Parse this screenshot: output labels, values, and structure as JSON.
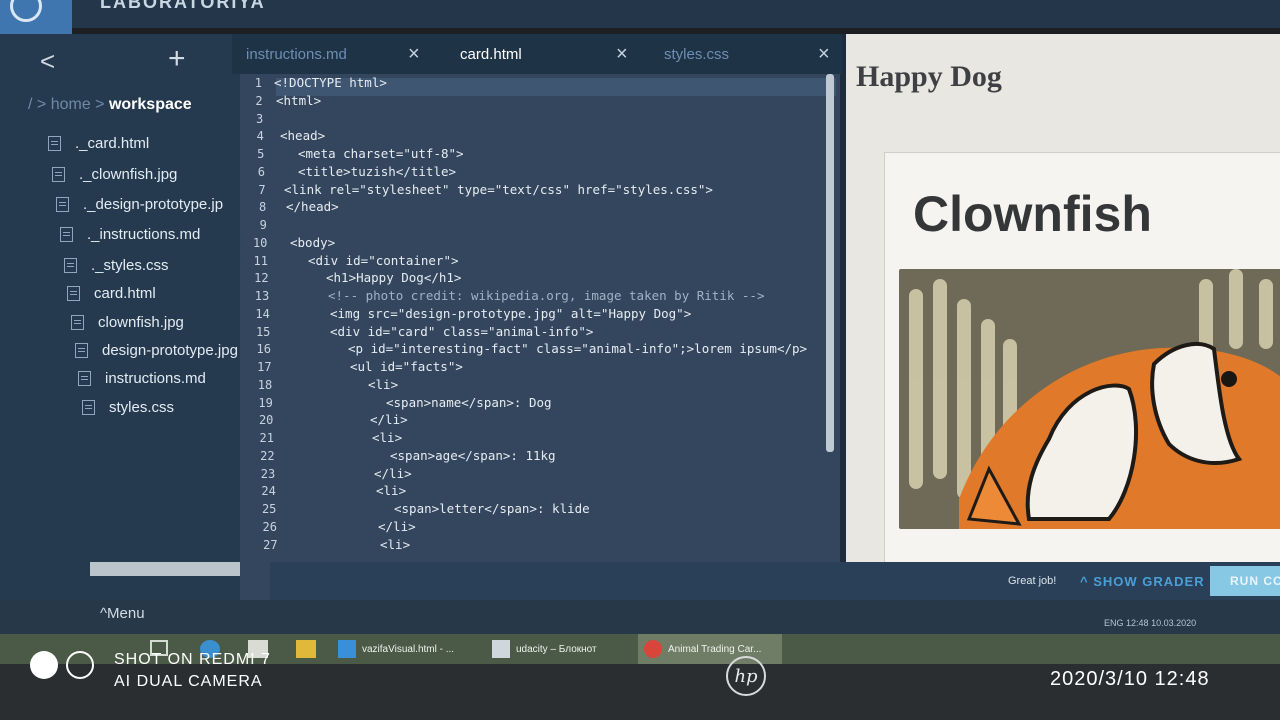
{
  "window": {
    "top_label": "LABORATORIYA"
  },
  "sidebar": {
    "back_glyph": "<",
    "add_glyph": "+",
    "breadcrumb": {
      "root": "/ >",
      "home": "home",
      "sep": " > ",
      "current": "workspace"
    },
    "files": [
      "._card.html",
      "._clownfish.jpg",
      "._design-prototype.jp",
      "._instructions.md",
      "._styles.css",
      "card.html",
      "clownfish.jpg",
      "design-prototype.jpg",
      "instructions.md",
      "styles.css"
    ]
  },
  "tabs": [
    {
      "label": "instructions.md",
      "close": "×"
    },
    {
      "label": "card.html",
      "close": "×"
    },
    {
      "label": "styles.css",
      "close": "×"
    }
  ],
  "editor": {
    "line_numbers": [
      "1",
      "2",
      "3",
      "4",
      "5",
      "6",
      "7",
      "8",
      "9",
      "10",
      "11",
      "12",
      "13",
      "14",
      "15",
      "16",
      "17",
      "18",
      "19",
      "20",
      "21",
      "22",
      "23",
      "24",
      "25",
      "26",
      "27"
    ],
    "lines": [
      "<!DOCTYPE html>",
      "<html>",
      "",
      "<head>",
      "<meta charset=\"utf-8\">",
      "<title>tuzish</title>",
      "<link rel=\"stylesheet\" type=\"text/css\" href=\"styles.css\">",
      "</head>",
      "",
      "<body>",
      "<div id=\"container\">",
      "<h1>Happy Dog</h1>",
      "<!-- photo credit: wikipedia.org, image taken by Ritik -->",
      "<img src=\"design-prototype.jpg\" alt=\"Happy Dog\">",
      "<div id=\"card\" class=\"animal-info\">",
      "<p id=\"interesting-fact\" class=\"animal-info\";>lorem ipsum</p>",
      "<ul id=\"facts\">",
      "<li>",
      "<span>name</span>: Dog",
      "</li>",
      "<li>",
      "<span>age</span>: 11kg",
      "</li>",
      "<li>",
      "<span>letter</span>: klide",
      "</li>",
      "<li>"
    ]
  },
  "preview": {
    "heading": "Happy Dog",
    "card_title": "Clownfish"
  },
  "footer": {
    "status": "Great job!",
    "grader": "SHOW GRADER",
    "run": "RUN CO",
    "menu": "Menu"
  },
  "tray": {
    "lang": "ENG",
    "time": "12:48",
    "date": "10.03.2020"
  },
  "taskbar": {
    "items": [
      {
        "label": "vazifaVisual.html - ...",
        "icon": "vscode-icon"
      },
      {
        "label": "udacity – Блокнот",
        "icon": "notepad-icon"
      },
      {
        "label": "Animal Trading Car...",
        "icon": "chrome-icon"
      }
    ]
  },
  "photo": {
    "watermark_line1": "SHOT ON REDMI 7",
    "watermark_line2": "AI DUAL CAMERA",
    "timestamp": "2020/3/10  12:48",
    "brand": "hp"
  },
  "colors": {
    "ide_bg": "#1e2c3c",
    "editor_bg": "#34465e",
    "accent_blue": "#4a9fd8",
    "preview_bg": "#e9e7e2"
  }
}
